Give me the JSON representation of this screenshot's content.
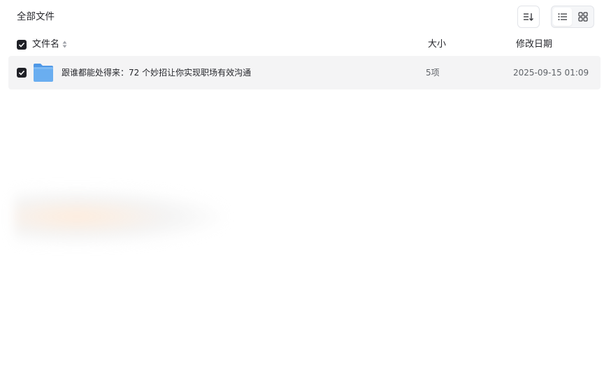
{
  "header": {
    "title": "全部文件",
    "sort_icon": "sort-icon",
    "view_icons": [
      "list-view-icon",
      "grid-view-icon"
    ]
  },
  "columns": {
    "name": "文件名",
    "size": "大小",
    "modified": "修改日期"
  },
  "files": [
    {
      "icon": "folder-icon",
      "name": "跟谁都能处得来：72 个妙招让你实现职场有效沟通",
      "size": "5项",
      "modified": "2025-09-15 01:09",
      "checked": true
    }
  ],
  "colors": {
    "row_background": "#f4f4f5",
    "checkbox": "#1f2026",
    "folder": "#6aaef0"
  }
}
